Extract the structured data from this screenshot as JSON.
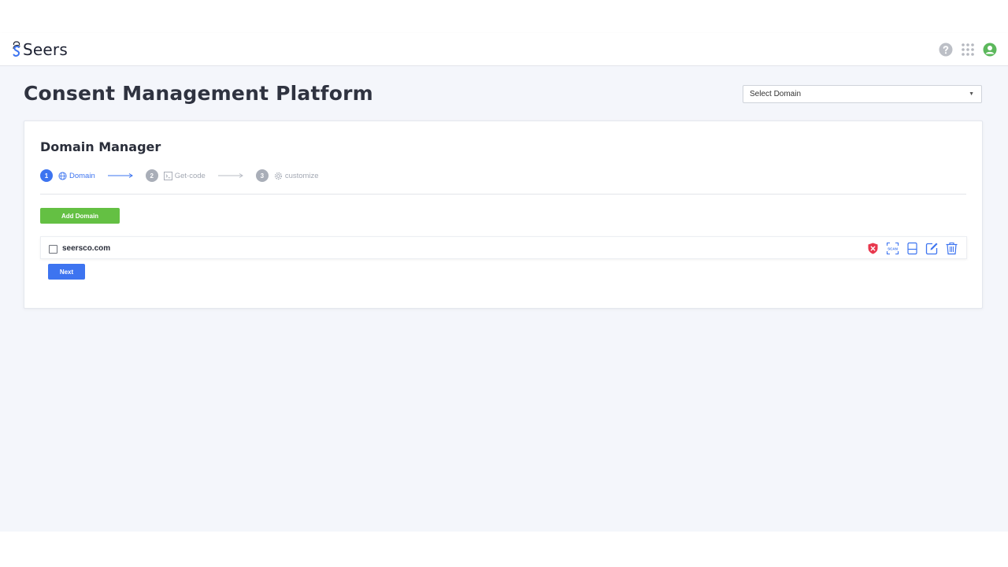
{
  "app": {
    "logo_text": "Seers"
  },
  "header": {
    "icons": [
      "help-icon",
      "apps-grid-icon",
      "user-account-icon"
    ]
  },
  "page": {
    "title": "Consent Management Platform",
    "domain_select": {
      "selected": "Select Domain",
      "caret": "▼"
    }
  },
  "card": {
    "title": "Domain Manager",
    "steps": [
      {
        "number": "1",
        "label": "Domain",
        "icon": "globe-icon",
        "active": true
      },
      {
        "number": "2",
        "label": "Get-code",
        "icon": "code-terminal-icon",
        "active": false
      },
      {
        "number": "3",
        "label": "customize",
        "icon": "gear-icon",
        "active": false
      }
    ],
    "add_button_label": "Add Domain",
    "domains": [
      {
        "name": "seersco.com",
        "checked": false,
        "actions": [
          "blocked-shield-icon",
          "scan-icon",
          "layout-icon",
          "edit-icon",
          "trash-icon"
        ]
      }
    ],
    "next_button_label": "Next"
  },
  "colors": {
    "primary_blue": "#3d74f0",
    "add_green": "#64c043",
    "danger_red": "#e8374d",
    "brand_green": "#5cb85c",
    "page_bg": "#f4f6fb"
  }
}
